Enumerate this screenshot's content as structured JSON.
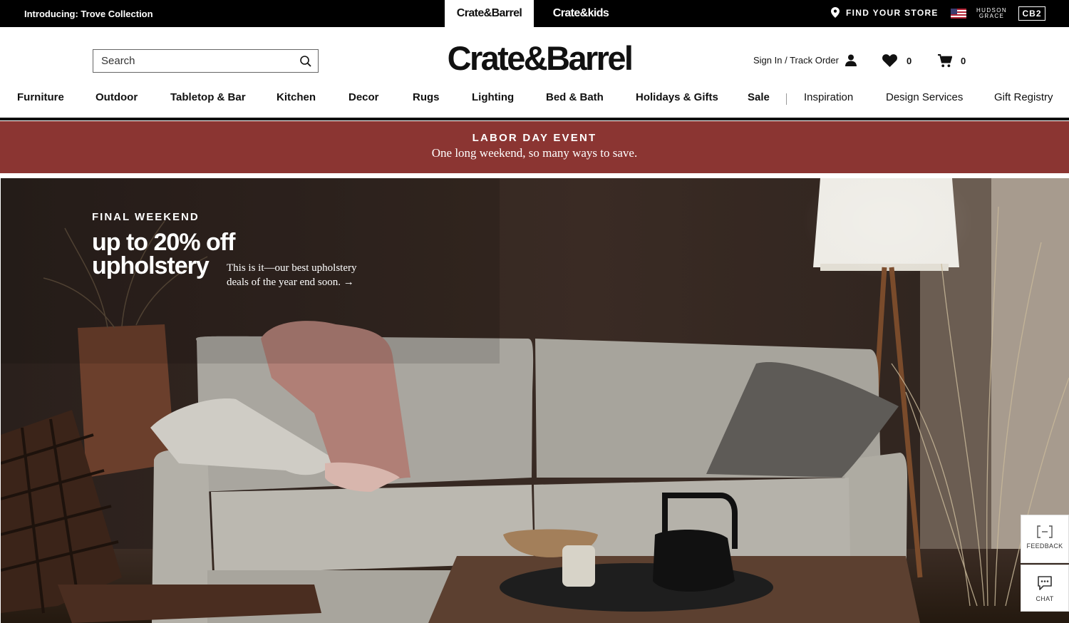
{
  "topbar": {
    "promo": "Introducing: Trove Collection",
    "brands": [
      "Crate&Barrel",
      "Crate&kids"
    ],
    "find_store": "FIND YOUR STORE",
    "hudson_line1": "HUDSON",
    "hudson_line2": "GRACE",
    "cb2": "CB2"
  },
  "header": {
    "search_placeholder": "Search",
    "logo": "Crate&Barrel",
    "signin": "Sign In / Track Order",
    "favorites_count": "0",
    "cart_count": "0"
  },
  "nav": {
    "items": [
      "Furniture",
      "Outdoor",
      "Tabletop & Bar",
      "Kitchen",
      "Decor",
      "Rugs",
      "Lighting",
      "Bed & Bath",
      "Holidays & Gifts",
      "Sale"
    ],
    "secondary": [
      "Inspiration",
      "Design Services",
      "Gift Registry"
    ]
  },
  "event": {
    "title": "LABOR DAY EVENT",
    "subtitle": "One long weekend, so many ways to save."
  },
  "hero": {
    "eyebrow": "FINAL WEEKEND",
    "headline": "up to 20% off upholstery",
    "copy": "This is it—our best upholstery deals of the year end soon. →"
  },
  "widgets": {
    "feedback": "FEEDBACK",
    "chat": "CHAT"
  },
  "colors": {
    "event_banner": "#8b3532",
    "topbar": "#000000"
  }
}
